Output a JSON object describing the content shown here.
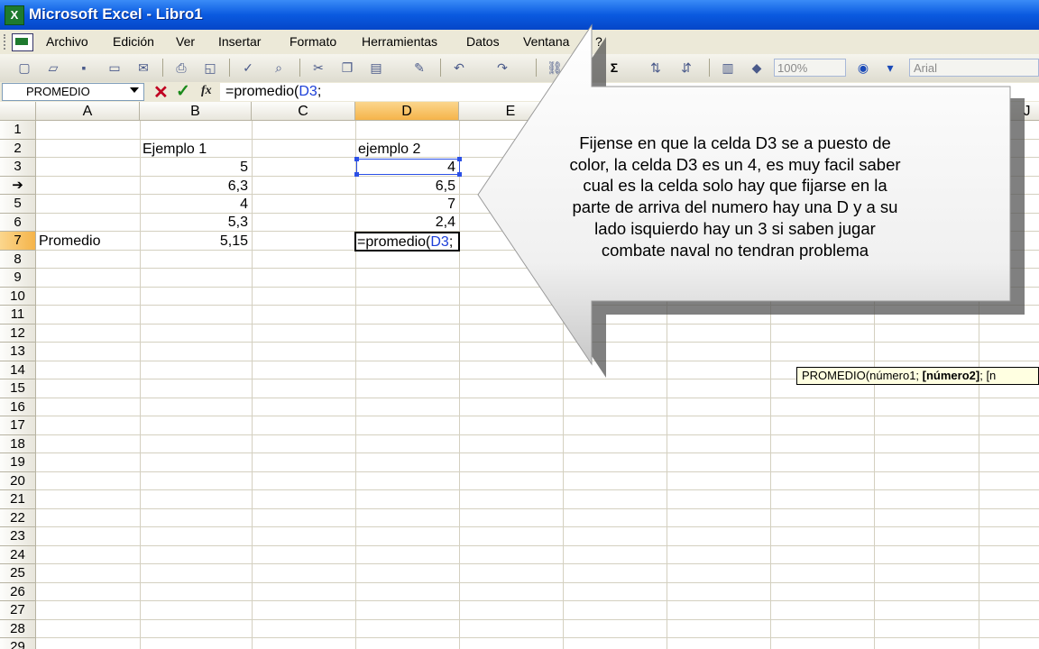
{
  "window": {
    "title": "Microsoft Excel - Libro1",
    "app_icon": "X"
  },
  "menu": [
    "Archivo",
    "Edición",
    "Ver",
    "Insertar",
    "Formato",
    "Herramientas",
    "Datos",
    "Ventana",
    "?"
  ],
  "toolbar": {
    "zoom": "100%",
    "font": "Arial",
    "sum_symbol": "Σ"
  },
  "formula_bar": {
    "name_box": "PROMEDIO",
    "fx": "fx",
    "formula_prefix": "=promedio(",
    "formula_ref": "D3",
    "formula_suffix": ";"
  },
  "columns": [
    "A",
    "B",
    "C",
    "D",
    "E",
    "J"
  ],
  "rows": [
    "1",
    "2",
    "3",
    "➔",
    "5",
    "6",
    "7",
    "8",
    "9",
    "10",
    "11",
    "12",
    "13",
    "14",
    "15",
    "16",
    "17",
    "18",
    "19",
    "20",
    "21",
    "22",
    "23",
    "24",
    "25",
    "26",
    "27",
    "28",
    "29"
  ],
  "cells": {
    "B2": "Ejemplo 1",
    "D2": "ejemplo 2",
    "B3": "5",
    "D3": "4",
    "B4": "6,3",
    "D4": "6,5",
    "B5": "4",
    "D5": "7",
    "B6": "5,3",
    "D6": "2,4",
    "A7": "Promedio",
    "B7": "5,15",
    "D7_prefix": "=promedio(",
    "D7_ref": "D3",
    "D7_suffix": ";"
  },
  "tooltip": {
    "prefix": "PROMEDIO(número1; ",
    "bold": "[número2]",
    "suffix": "; [n"
  },
  "callout": {
    "lines": [
      "Fijense en que la celda D3 se a puesto de",
      "color, la celda D3 es un 4, es muy facil saber",
      "cual es la celda solo hay que fijarse en la",
      "parte de arriva del numero hay una D y a su",
      "lado isquierdo hay un 3 si saben jugar",
      "combate naval no tendran problema"
    ]
  }
}
